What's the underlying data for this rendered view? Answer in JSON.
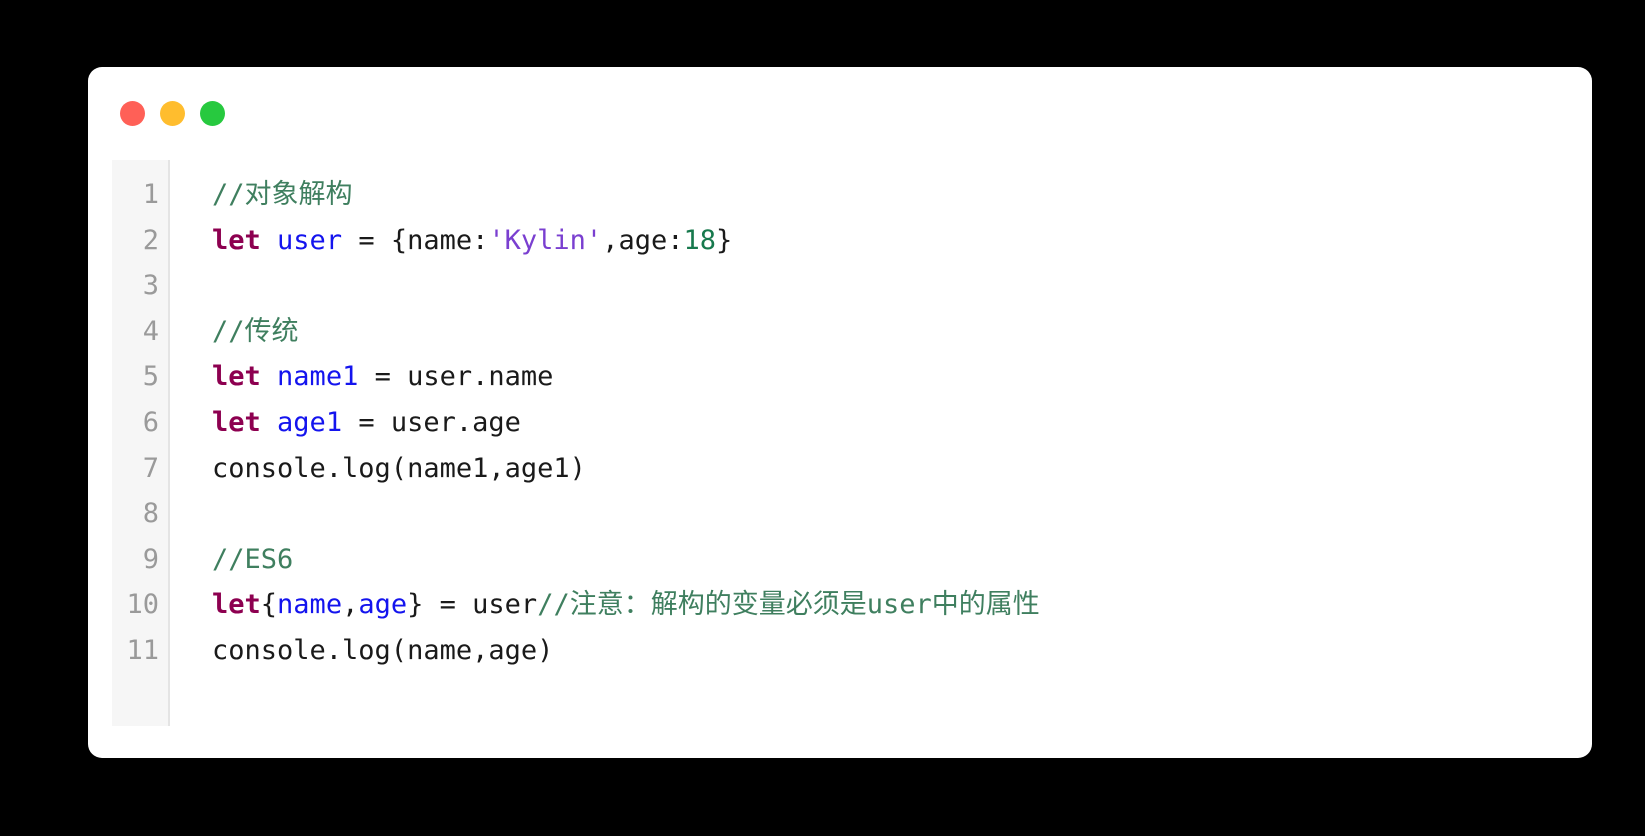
{
  "window": {
    "title_bar": {
      "buttons": [
        {
          "name": "close-dot",
          "label": "close",
          "color": "#ff6057"
        },
        {
          "name": "minimize-dot",
          "label": "minimize",
          "color": "#ffbd2e"
        },
        {
          "name": "maximize-dot",
          "label": "maximize",
          "color": "#27c93f"
        }
      ]
    },
    "background_color": "#ffffff",
    "page_background": "#000000"
  },
  "editor": {
    "gutter_background": "#f6f6f6",
    "line_number_color": "#9a9a9a",
    "line_numbers": [
      "1",
      "2",
      "3",
      "4",
      "5",
      "6",
      "7",
      "8",
      "9",
      "10",
      "11"
    ],
    "syntax_colors": {
      "comment": "#3f7f5f",
      "keyword": "#8d0050",
      "variable": "#1414ee",
      "string": "#7a3fd0",
      "number": "#17794d",
      "plain": "#1a1a1a"
    },
    "lines": [
      {
        "number": "1",
        "text": "//对象解构"
      },
      {
        "number": "2",
        "text": "let user = {name:'Kylin',age:18}"
      },
      {
        "number": "3",
        "text": ""
      },
      {
        "number": "4",
        "text": "//传统"
      },
      {
        "number": "5",
        "text": "let name1 = user.name"
      },
      {
        "number": "6",
        "text": "let age1 = user.age"
      },
      {
        "number": "7",
        "text": "console.log(name1,age1)"
      },
      {
        "number": "8",
        "text": ""
      },
      {
        "number": "9",
        "text": "//ES6"
      },
      {
        "number": "10",
        "text": "let{name,age} = user//注意：解构的变量必须是user中的属性"
      },
      {
        "number": "11",
        "text": "console.log(name,age)"
      }
    ],
    "tokens": {
      "line1": {
        "comment": "//对象解构"
      },
      "line2": {
        "keyword": "let",
        "space1": " ",
        "variable": "user",
        "op": " = {name:",
        "string": "'Kylin'",
        "mid": ",age:",
        "number": "18",
        "close": "}"
      },
      "line4": {
        "comment": "//传统"
      },
      "line5": {
        "keyword": "let",
        "space1": " ",
        "variable": "name1",
        "rest": " = user.name"
      },
      "line6": {
        "keyword": "let",
        "space1": " ",
        "variable": "age1",
        "rest": " = user.age"
      },
      "line7": {
        "plain": "console.log(name1,age1)"
      },
      "line9": {
        "comment": "//ES6"
      },
      "line10": {
        "keyword": "let",
        "brace_open": "{",
        "var1": "name",
        "comma": ",",
        "var2": "age",
        "brace_close": "}",
        "assign": " = user",
        "comment": "//注意：解构的变量必须是user中的属性"
      },
      "line11": {
        "plain": "console.log(name,age)"
      }
    }
  }
}
